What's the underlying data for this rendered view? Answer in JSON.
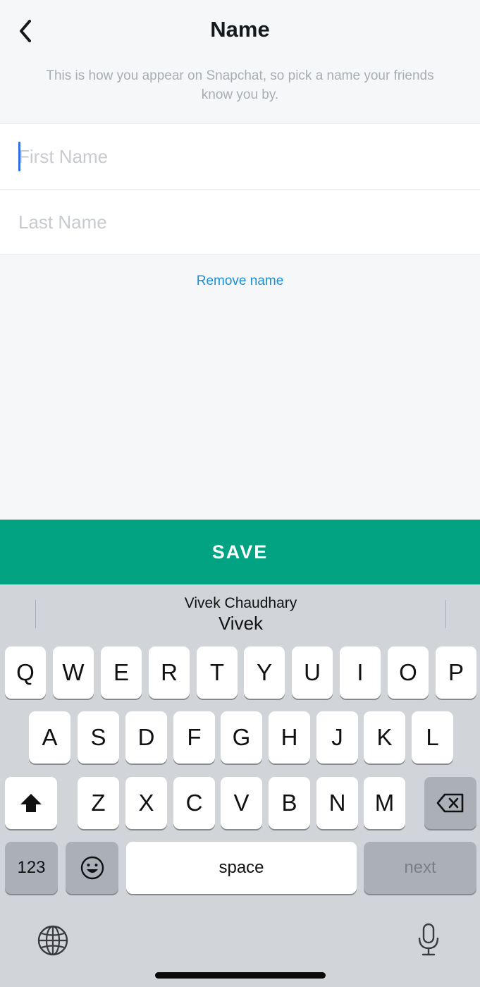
{
  "header": {
    "title": "Name",
    "subtitle": "This is how you appear on Snapchat, so pick a name your friends know you by."
  },
  "form": {
    "first_name": {
      "value": "",
      "placeholder": "First Name"
    },
    "last_name": {
      "value": "",
      "placeholder": "Last Name"
    },
    "remove_label": "Remove name"
  },
  "save": {
    "label": "SAVE"
  },
  "colors": {
    "accent": "#02a383",
    "link": "#1a8fd8",
    "caret": "#2f6ee6"
  },
  "keyboard": {
    "suggestion_full": "Vivek Chaudhary",
    "suggestion_first": "Vivek",
    "row1": [
      "Q",
      "W",
      "E",
      "R",
      "T",
      "Y",
      "U",
      "I",
      "O",
      "P"
    ],
    "row2": [
      "A",
      "S",
      "D",
      "F",
      "G",
      "H",
      "J",
      "K",
      "L"
    ],
    "row3": [
      "Z",
      "X",
      "C",
      "V",
      "B",
      "N",
      "M"
    ],
    "numbers_label": "123",
    "space_label": "space",
    "next_label": "next",
    "icons": [
      "shift-icon",
      "delete-icon",
      "emoji-icon",
      "globe-icon",
      "microphone-icon"
    ]
  }
}
